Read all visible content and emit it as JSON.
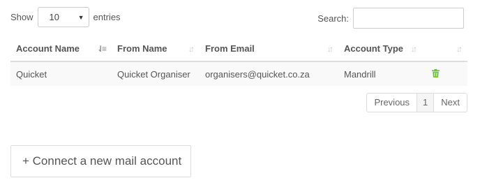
{
  "length": {
    "prefix": "Show",
    "value": "10",
    "suffix": "entries"
  },
  "search": {
    "label": "Search:",
    "value": "",
    "placeholder": ""
  },
  "table": {
    "headers": [
      "Account Name",
      "From Name",
      "From Email",
      "Account Type",
      ""
    ],
    "rows": [
      {
        "account_name": "Quicket",
        "from_name": "Quicket Organiser",
        "from_email": "organisers@quicket.co.za",
        "account_type": "Mandrill",
        "action_icon": "trash-icon"
      }
    ]
  },
  "pagination": {
    "previous": "Previous",
    "page": "1",
    "next": "Next"
  },
  "connect_button": "+ Connect a new mail account",
  "colors": {
    "trash": "#6fbf2e",
    "border": "#dddddd",
    "row_bg": "#f9f9f9"
  }
}
